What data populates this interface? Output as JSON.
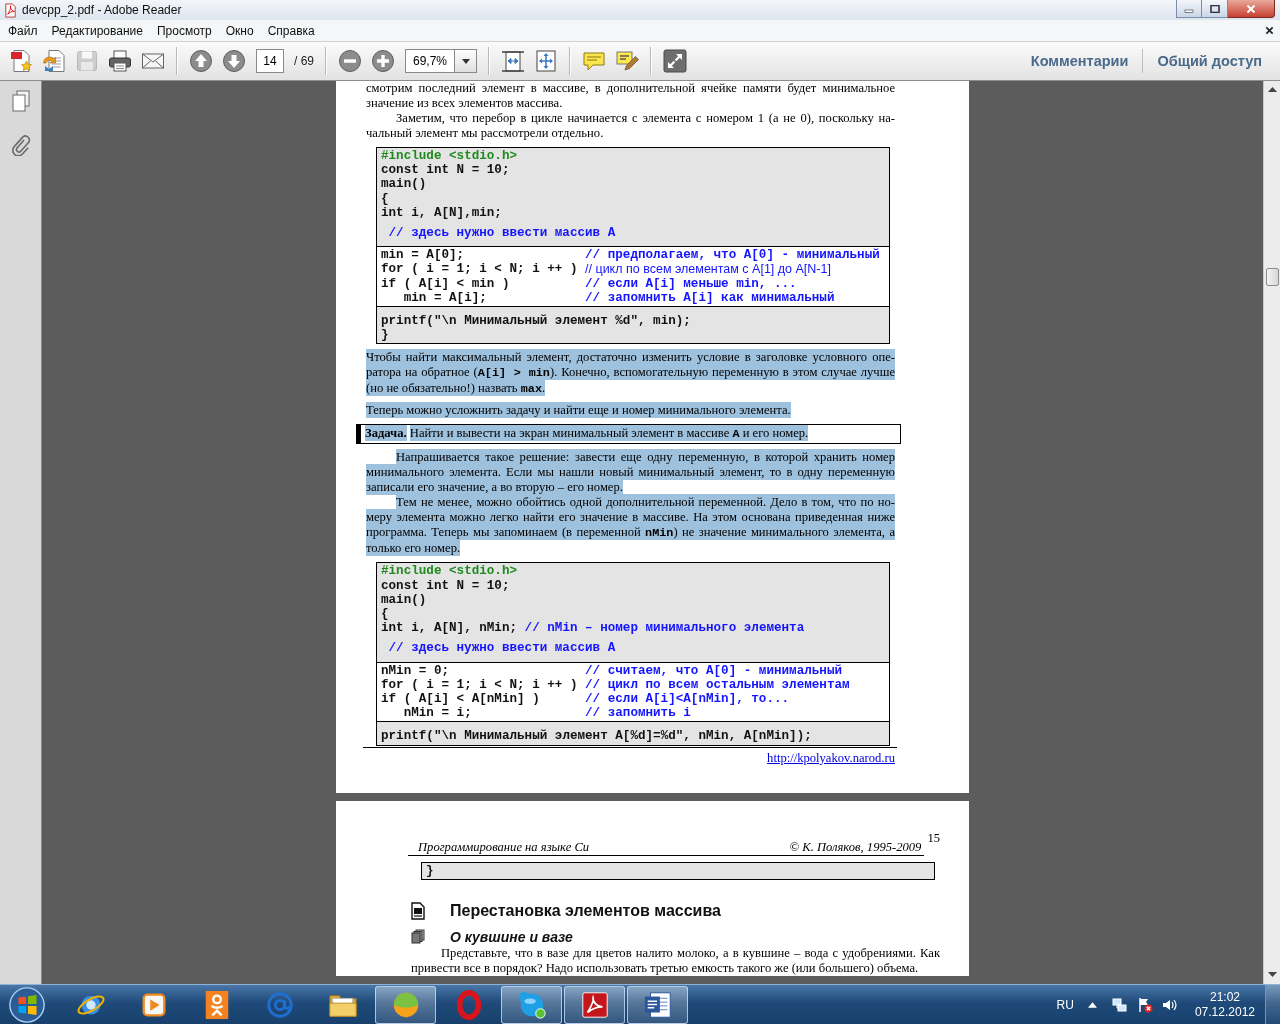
{
  "window": {
    "title": "devcpp_2.pdf - Adobe Reader"
  },
  "menu": [
    "Файл",
    "Редактирование",
    "Просмотр",
    "Окно",
    "Справка"
  ],
  "toolbar": {
    "file_tools": [
      {
        "kind": "create",
        "disabled": false
      },
      {
        "kind": "export",
        "disabled": false
      },
      {
        "kind": "save",
        "disabled": true
      },
      {
        "kind": "print",
        "disabled": false
      },
      {
        "kind": "mail",
        "disabled": false
      }
    ],
    "nav_tools": [
      {
        "kind": "up",
        "disabled": false
      },
      {
        "kind": "down",
        "disabled": false
      }
    ],
    "page_number": "14",
    "page_count": "/ 69",
    "zoom_tools": [
      {
        "kind": "minus",
        "disabled": false
      },
      {
        "kind": "plus",
        "disabled": false
      }
    ],
    "zoom_value": "69,7%",
    "view_tools": [
      {
        "kind": "fit-width",
        "disabled": false
      },
      {
        "kind": "fit-page",
        "disabled": false
      }
    ],
    "comment_tools": [
      {
        "kind": "note",
        "disabled": false
      },
      {
        "kind": "highlight",
        "disabled": false
      }
    ],
    "mode_tools": [
      {
        "kind": "expand",
        "disabled": false
      }
    ],
    "panels": [
      "Комментарии",
      "Общий доступ"
    ]
  },
  "document": {
    "pages": [
      {
        "blocks": [
          {
            "kind": "paragraph",
            "selected": false,
            "text": "смотрим последний элемент в массиве, в дополнительной ячейке памяти будет минимальное значение из всех элементов массива."
          },
          {
            "kind": "indented",
            "selected": false,
            "text": "Заметим, что перебор в цикле начинается с элемента с номером 1 (а не 0), поскольку на-чальный элемент мы рассмотрели отдельно."
          },
          {
            "kind": "code",
            "selected": false,
            "sections": [
              {
                "shaded": true,
                "lines": [
                  {
                    "kind": "directive",
                    "code": "#include <stdio.h>"
                  },
                  {
                    "kind": "code",
                    "code": "const int N = 10;"
                  },
                  {
                    "kind": "code",
                    "code": "main()"
                  },
                  {
                    "kind": "code",
                    "code": "{"
                  },
                  {
                    "kind": "code",
                    "code": "int i, A[N],min;"
                  },
                  {
                    "kind": "comment",
                    "comment": "// здесь нужно ввести массив A"
                  }
                ]
              },
              {
                "shaded": false,
                "lines": [
                  {
                    "kind": "code",
                    "code": "min = A[0];",
                    "comment": "// предполагаем, что A[0] - минимальный"
                  },
                  {
                    "kind": "sans",
                    "code": "for ( i = 1; i < N; i ++ )",
                    "comment": "// цикл по всем элементам с A[1] до A[N-1]"
                  },
                  {
                    "kind": "code",
                    "code": "if ( A[i] < min )",
                    "comment": "// если A[i] меньше min, ...",
                    "children": [
                      {
                        "kind": "code",
                        "code": "min = A[i];",
                        "comment": "// запомнить A[i] как минимальный"
                      }
                    ]
                  }
                ]
              },
              {
                "shaded": true,
                "lines": [
                  {
                    "kind": "code",
                    "code": "printf(\"\\n Минимальный элемент %d\", min);"
                  },
                  {
                    "kind": "code",
                    "code": "}"
                  }
                ]
              }
            ]
          },
          {
            "kind": "paragraph",
            "selected": true,
            "text": "Чтобы найти максимальный элемент, достаточно изменить условие в заголовке условного опе-ратора на обратное (**A[i] > min**). Конечно, вспомогательную переменную в этом случае лучше (но не обязательно!) назвать **max**."
          },
          {
            "kind": "paragraph",
            "selected": true,
            "text": "Теперь можно усложнить задачу и найти еще и номер минимального элемента."
          },
          {
            "kind": "task",
            "selected": true,
            "label": "Задача.",
            "text": "Найти и вывести на экран минимальный элемент в массиве **A** и его номер."
          },
          {
            "kind": "indented",
            "selected": true,
            "text": "Напрашивается такое решение: завести еще одну переменную, в которой хранить номер минимального элемента. Если мы нашли новый минимальный элемент, то в одну переменную записали его значение, а во вторую – его номер."
          },
          {
            "kind": "indented",
            "selected": true,
            "text": "Тем не менее, можно обойтись одной дополнительной переменной. Дело в том, что по но-меру элемента можно легко найти его значение в массиве. На этом основана приведенная ниже программа. Теперь мы запоминаем (в переменной **nMin**) не значение минимального элемента, а только его номер."
          },
          {
            "kind": "code",
            "selected": false,
            "sections": [
              {
                "shaded": true,
                "lines": [
                  {
                    "kind": "directive",
                    "code": "#include <stdio.h>"
                  },
                  {
                    "kind": "code",
                    "code": "const int N = 10;"
                  },
                  {
                    "kind": "code",
                    "code": "main()"
                  },
                  {
                    "kind": "code",
                    "code": "{"
                  },
                  {
                    "kind": "code",
                    "code": "int i, A[N], nMin;",
                    "comment": "// nMin – номер минимального элемента"
                  },
                  {
                    "kind": "comment",
                    "comment": "// здесь нужно ввести массив A"
                  }
                ]
              },
              {
                "shaded": false,
                "lines": [
                  {
                    "kind": "code",
                    "code": "nMin = 0;",
                    "comment": "// считаем, что A[0] - минимальный"
                  },
                  {
                    "kind": "code",
                    "code": "for ( i = 1; i < N; i ++ )",
                    "comment": "// цикл по всем остальным элементам"
                  },
                  {
                    "kind": "code",
                    "code": "if ( A[i] < A[nMin] )",
                    "comment": "// если A[i]<A[nMin], то...",
                    "children": [
                      {
                        "kind": "code",
                        "code": "nMin = i;",
                        "comment": "// запомнить i"
                      }
                    ]
                  }
                ]
              },
              {
                "shaded": true,
                "lines": [
                  {
                    "kind": "code",
                    "code": "printf(\"\\n Минимальный элемент A[%d]=%d\", nMin, A[nMin]);"
                  }
                ]
              }
            ]
          }
        ],
        "link": "http://kpolyakov.narod.ru"
      },
      {
        "number": "15",
        "header_left": "Программирование на языке Си",
        "header_right": "© К. Поляков, 1995-2009",
        "blocks": [
          {
            "kind": "code",
            "selected": false,
            "sections": [
              {
                "shaded": true,
                "lines": [
                  {
                    "kind": "code",
                    "code": "}"
                  }
                ]
              }
            ]
          },
          {
            "kind": "heading",
            "selected": false,
            "text": "Перестановка элементов массива"
          },
          {
            "kind": "subheading",
            "selected": false,
            "text": "О кувшине и вазе"
          },
          {
            "kind": "indented",
            "selected": false,
            "text": "Представьте, что в вазе для цветов налито молоко, а в кувшине – вода с удобрениями. Как привести все в порядок? Надо использовать третью емкость такого же (или большего) объема."
          }
        ]
      }
    ]
  },
  "taskbar": {
    "apps": [
      {
        "kind": "globe",
        "open": false
      },
      {
        "kind": "play",
        "open": false
      },
      {
        "kind": "person",
        "open": false
      },
      {
        "kind": "at",
        "open": false
      },
      {
        "kind": "folder",
        "open": false
      },
      {
        "kind": "ball",
        "open": true
      },
      {
        "kind": "ring",
        "open": false
      },
      {
        "kind": "chat",
        "open": true
      },
      {
        "kind": "pdf",
        "open": true
      },
      {
        "kind": "letter",
        "open": true
      }
    ],
    "language": "RU",
    "time": "21:02",
    "date": "07.12.2012"
  }
}
